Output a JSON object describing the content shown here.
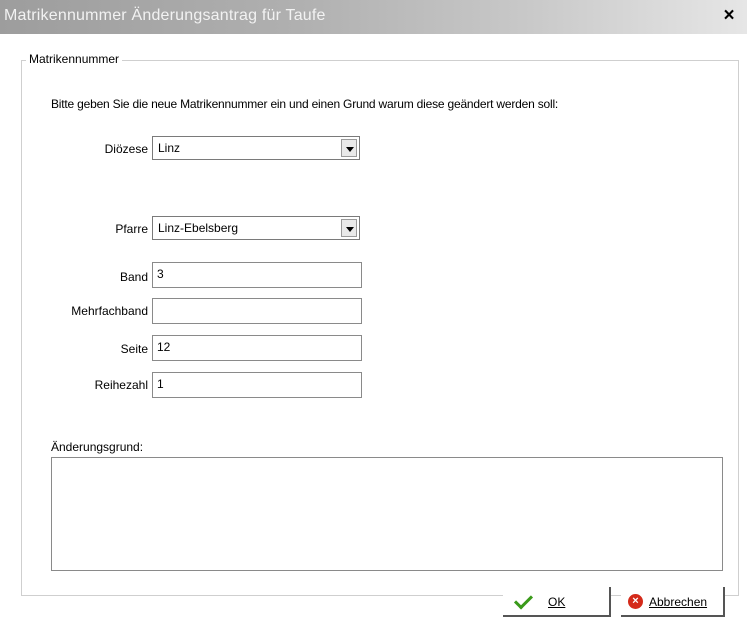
{
  "window": {
    "title": "Matrikennummer Änderungsantrag für Taufe",
    "close_label": "×"
  },
  "group": {
    "legend": "Matrikennummer",
    "instruction": "Bitte geben Sie die neue Matrikennummer ein und einen Grund warum diese geändert werden soll:"
  },
  "form": {
    "dioezese": {
      "label": "Diözese",
      "value": "Linz"
    },
    "pfarre": {
      "label": "Pfarre",
      "value": "Linz-Ebelsberg"
    },
    "band": {
      "label": "Band",
      "value": "3"
    },
    "mehrfachband": {
      "label": "Mehrfachband",
      "value": ""
    },
    "seite": {
      "label": "Seite",
      "value": "12"
    },
    "reihezahl": {
      "label": "Reihezahl",
      "value": "1"
    },
    "grund": {
      "label": "Änderungsgrund:",
      "value": ""
    }
  },
  "buttons": {
    "ok": {
      "label": "OK",
      "icon": "checkmark-icon",
      "color": "#3a9a1a"
    },
    "cancel": {
      "label": "Abbrechen",
      "icon": "cancel-icon",
      "color": "#d42a1a"
    }
  }
}
